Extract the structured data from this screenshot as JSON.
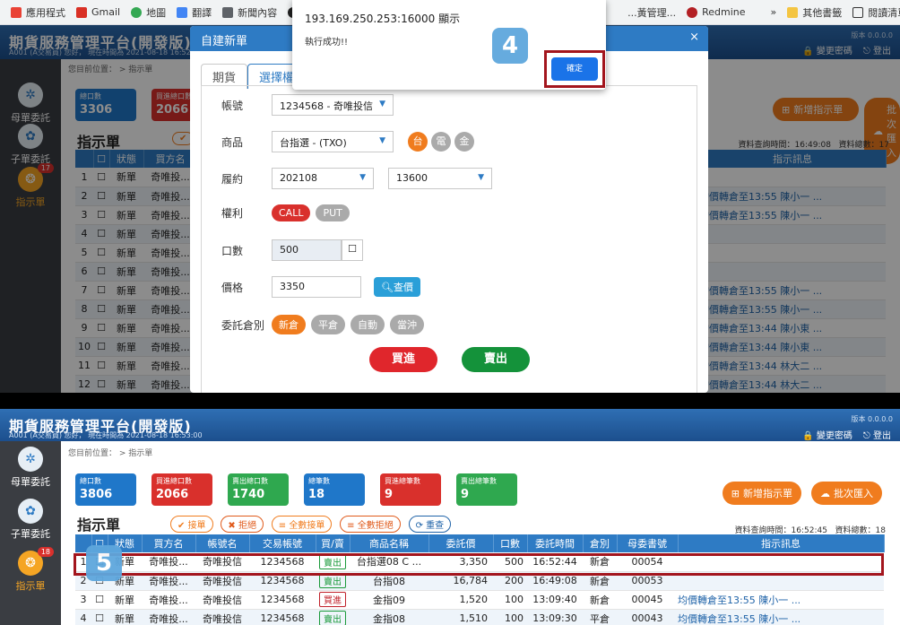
{
  "browser": {
    "bookmarks": [
      {
        "label": "應用程式",
        "icon": "apps-grid-icon",
        "color": "#e94235"
      },
      {
        "label": "Gmail",
        "icon": "gmail-icon",
        "color": "#d93025"
      },
      {
        "label": "地圖",
        "icon": "maps-pin-icon",
        "color": "#34a853"
      },
      {
        "label": "翻譯",
        "icon": "translate-icon",
        "color": "#4285f4"
      },
      {
        "label": "新聞內容",
        "icon": "news-icon",
        "color": "#5f6368"
      },
      {
        "label": "",
        "icon": "globe-icon",
        "color": "#222222"
      }
    ],
    "bookmarks_right": [
      {
        "label": "...黃管理...",
        "icon": "bookmark-icon"
      },
      {
        "label": "Redmine",
        "icon": "redmine-icon"
      },
      {
        "label": "»",
        "icon": "overflow-chevron-icon"
      },
      {
        "label": "其他書籤",
        "icon": "folder-icon"
      },
      {
        "label": "閱讀清單",
        "icon": "reading-list-icon"
      }
    ]
  },
  "app": {
    "title": "期貨服務管理平台(開發版)",
    "user_line": "A001 (A交易員)   您好，  現在時間為  2021-08-18 16:52:4",
    "user_line_bottom": "A001 (A交易員)   您好，  現在時間為  2021-08-18 16:53:00",
    "version": "版本 0.0.0.0",
    "change_password": "變更密碼",
    "logout": "登出",
    "breadcrumb": "您目前位置：  >  指示單"
  },
  "sidebar": {
    "items": [
      {
        "label": "母單委託",
        "icon": "tree-parent-order-icon"
      },
      {
        "label": "子單委託",
        "icon": "child-order-icon"
      },
      {
        "label": "指示單",
        "icon": "instruction-order-icon",
        "badge_top": "17",
        "badge_bottom": "18"
      }
    ]
  },
  "stats": [
    {
      "label": "總口數",
      "value": "3306",
      "value_bottom": "3806",
      "color": "#1f77c9"
    },
    {
      "label": "買進總口數",
      "value": "2066",
      "value_bottom": "2066",
      "color": "#d9302c"
    },
    {
      "label": "賣出總口數",
      "value": "",
      "value_bottom": "1740",
      "color": "#2fa84f"
    },
    {
      "label": "總筆數",
      "value": "",
      "value_bottom": "18",
      "color": "#1f77c9"
    },
    {
      "label": "買進總筆數",
      "value": "",
      "value_bottom": "9",
      "color": "#d9302c"
    },
    {
      "label": "賣出總筆數",
      "value": "",
      "value_bottom": "9",
      "color": "#2fa84f"
    }
  ],
  "toolbar": {
    "new_instruction": "新增指示單",
    "batch_import": "批次匯入",
    "section_title": "指示單",
    "accept": "接單",
    "reject": "拒絕",
    "accept_all": "全數接單",
    "reject_all": "全數拒絕",
    "reset": "重查",
    "query_time_top": "資料查詢時間：16:49:08",
    "total_top": "資料總數：17",
    "query_time_bottom": "資料查詢時間：16:52:45",
    "total_bottom": "資料總數：18"
  },
  "table": {
    "columns": [
      "",
      "",
      "狀態",
      "買方名",
      "帳號名",
      "交易帳號",
      "買/賣",
      "商品名稱",
      "委託價",
      "口數",
      "委託時間",
      "倉別",
      "母委書號",
      "指示訊息"
    ],
    "top_rows": [
      {
        "n": "1",
        "status": "新單",
        "buyer": "奇唯投...",
        "msg": ""
      },
      {
        "n": "2",
        "status": "新單",
        "buyer": "奇唯投...",
        "msg": "均價轉倉至13:55  陳小一 ..."
      },
      {
        "n": "3",
        "status": "新單",
        "buyer": "奇唯投...",
        "msg": "均價轉倉至13:55  陳小一 ..."
      },
      {
        "n": "4",
        "status": "新單",
        "buyer": "奇唯投...",
        "msg": ""
      },
      {
        "n": "5",
        "status": "新單",
        "buyer": "奇唯投...",
        "msg": ""
      },
      {
        "n": "6",
        "status": "新單",
        "buyer": "奇唯投...",
        "msg": ""
      },
      {
        "n": "7",
        "status": "新單",
        "buyer": "奇唯投...",
        "msg": "均價轉倉至13:55  陳小一 ..."
      },
      {
        "n": "8",
        "status": "新單",
        "buyer": "奇唯投...",
        "msg": "均價轉倉至13:55  陳小一 ..."
      },
      {
        "n": "9",
        "status": "新單",
        "buyer": "奇唯投...",
        "msg": "均價轉倉至13:44  陳小東 ..."
      },
      {
        "n": "10",
        "status": "新單",
        "buyer": "奇唯投...",
        "msg": "均價轉倉至13:44  陳小東 ..."
      },
      {
        "n": "11",
        "status": "新單",
        "buyer": "奇唯投...",
        "msg": "均價轉倉至13:44  林大二 ..."
      },
      {
        "n": "12",
        "status": "新單",
        "buyer": "奇唯投...",
        "msg": "均價轉倉至13:44  林大二 ..."
      }
    ],
    "bottom_rows": [
      {
        "n": "1",
        "status": "新單",
        "buyer": "奇唯投...",
        "acct_name": "奇唯投信",
        "acct": "1234568",
        "side": "賣出",
        "side_type": "sell",
        "product": "台指選08 C ...",
        "price": "3,350",
        "qty": "500",
        "time": "16:52:44",
        "pos": "新倉",
        "parent": "00054",
        "msg": ""
      },
      {
        "n": "2",
        "status": "新單",
        "buyer": "奇唯投...",
        "acct_name": "奇唯投信",
        "acct": "1234568",
        "side": "賣出",
        "side_type": "sell",
        "product": "台指08",
        "price": "16,784",
        "qty": "200",
        "time": "16:49:08",
        "pos": "新倉",
        "parent": "00053",
        "msg": ""
      },
      {
        "n": "3",
        "status": "新單",
        "buyer": "奇唯投...",
        "acct_name": "奇唯投信",
        "acct": "1234568",
        "side": "買進",
        "side_type": "buy",
        "product": "金指09",
        "price": "1,520",
        "qty": "100",
        "time": "13:09:40",
        "pos": "新倉",
        "parent": "00045",
        "msg": "均價轉倉至13:55  陳小一 ..."
      },
      {
        "n": "4",
        "status": "新單",
        "buyer": "奇唯投...",
        "acct_name": "奇唯投信",
        "acct": "1234568",
        "side": "賣出",
        "side_type": "sell",
        "product": "金指08",
        "price": "1,510",
        "qty": "100",
        "time": "13:09:30",
        "pos": "平倉",
        "parent": "00043",
        "msg": "均價轉倉至13:55  陳小一 ..."
      }
    ]
  },
  "modal": {
    "title": "自建新單",
    "close": "×",
    "tab_futures": "期貨",
    "tab_options": "選擇權",
    "account_label": "帳號",
    "account_value": "1234568 - 奇唯投信",
    "product_label": "商品",
    "product_value": "台指選 - (TXO)",
    "product_chips": [
      {
        "label": "台",
        "color": "#f07c1e"
      },
      {
        "label": "電",
        "color": "#aaaaaa"
      },
      {
        "label": "金",
        "color": "#aaaaaa"
      }
    ],
    "contract_label": "履約",
    "contract_month": "202108",
    "strike": "13600",
    "right_label": "權利",
    "call": "CALL",
    "put": "PUT",
    "qty_label": "口數",
    "qty_value": "500",
    "price_label": "價格",
    "price_value": "3350",
    "query_price": "查價",
    "position_label": "委託倉別",
    "positions": [
      {
        "label": "新倉",
        "color": "#f07c1e"
      },
      {
        "label": "平倉",
        "color": "#aaaaaa"
      },
      {
        "label": "自動",
        "color": "#aaaaaa"
      },
      {
        "label": "當沖",
        "color": "#aaaaaa"
      }
    ],
    "buy": "買進",
    "sell": "賣出"
  },
  "alert": {
    "title": "193.169.250.253:16000 顯示",
    "message": "執行成功!!",
    "ok": "確定"
  },
  "steps": {
    "four": "4",
    "five": "5"
  }
}
